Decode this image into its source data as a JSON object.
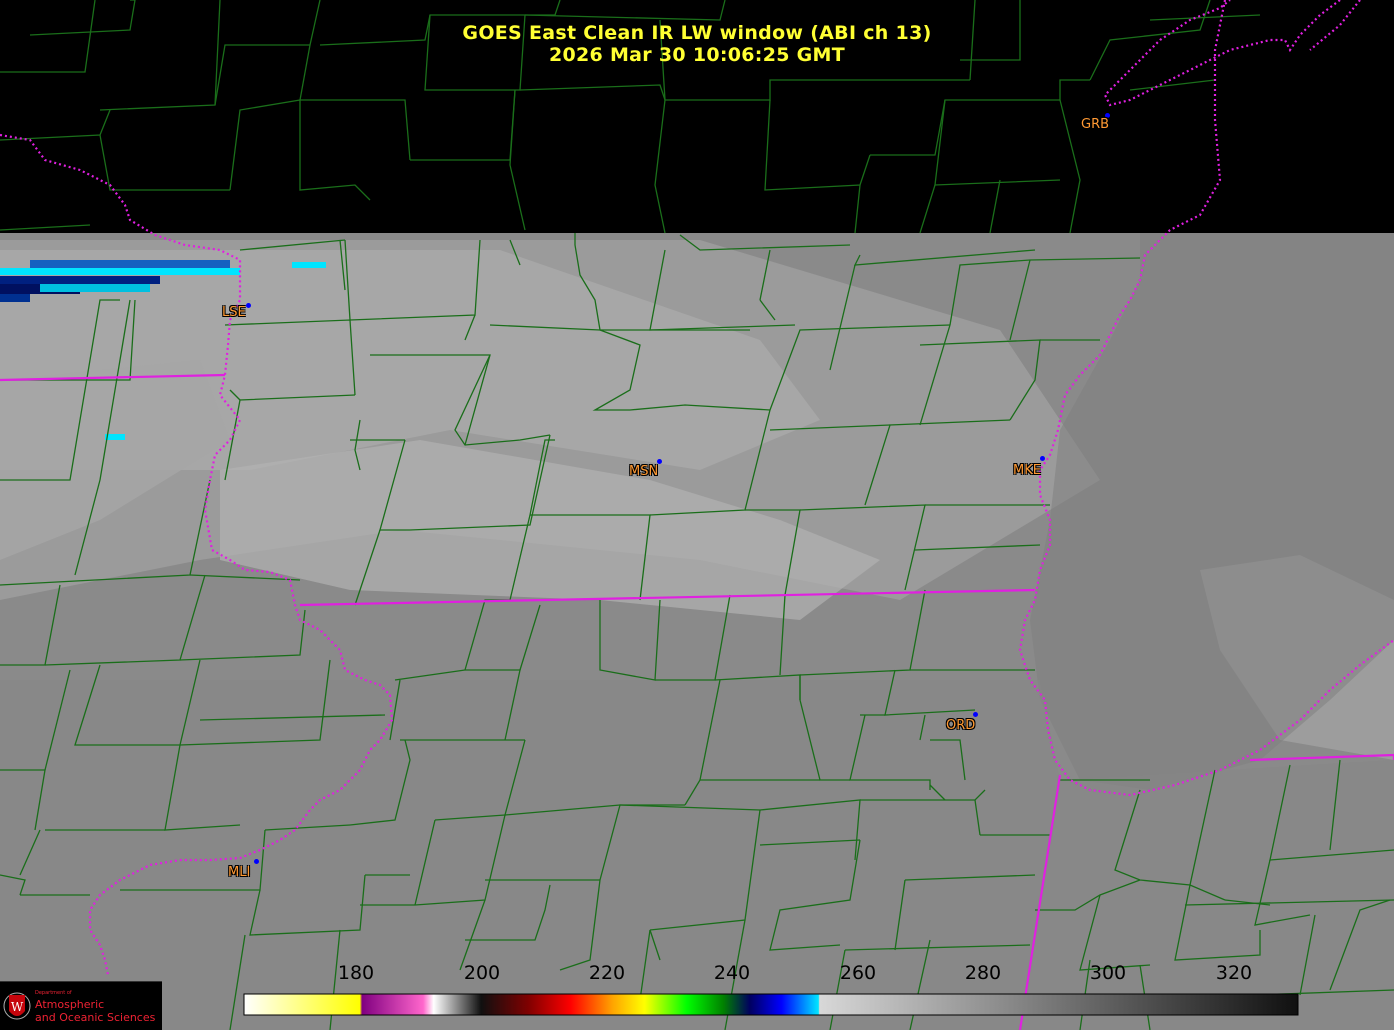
{
  "header": {
    "title_line1": "GOES East Clean IR LW window (ABI ch 13)",
    "title_line2": "2026 Mar 30  10:06:25 GMT"
  },
  "stations": [
    {
      "id": "lse",
      "label": "LSE"
    },
    {
      "id": "msn",
      "label": "MSN"
    },
    {
      "id": "mke",
      "label": "MKE"
    },
    {
      "id": "grb",
      "label": "GRB"
    },
    {
      "id": "ord",
      "label": "ORD"
    },
    {
      "id": "mli",
      "label": "MLI"
    }
  ],
  "colorbar": {
    "min": 163,
    "max": 330,
    "ticks": [
      "180",
      "200",
      "220",
      "240",
      "260",
      "280",
      "300",
      "320"
    ]
  },
  "colors": {
    "title": "#ffff33",
    "station_label": "#ff9933",
    "station_dot": "#0000ff",
    "county_lines": "#1a6e1a",
    "state_lines": "#e020e0",
    "cloud_cold": "#00e5ff"
  },
  "logo": {
    "dept": "Department of",
    "line1": "Atmospheric",
    "line2": "and Oceanic Sciences"
  }
}
